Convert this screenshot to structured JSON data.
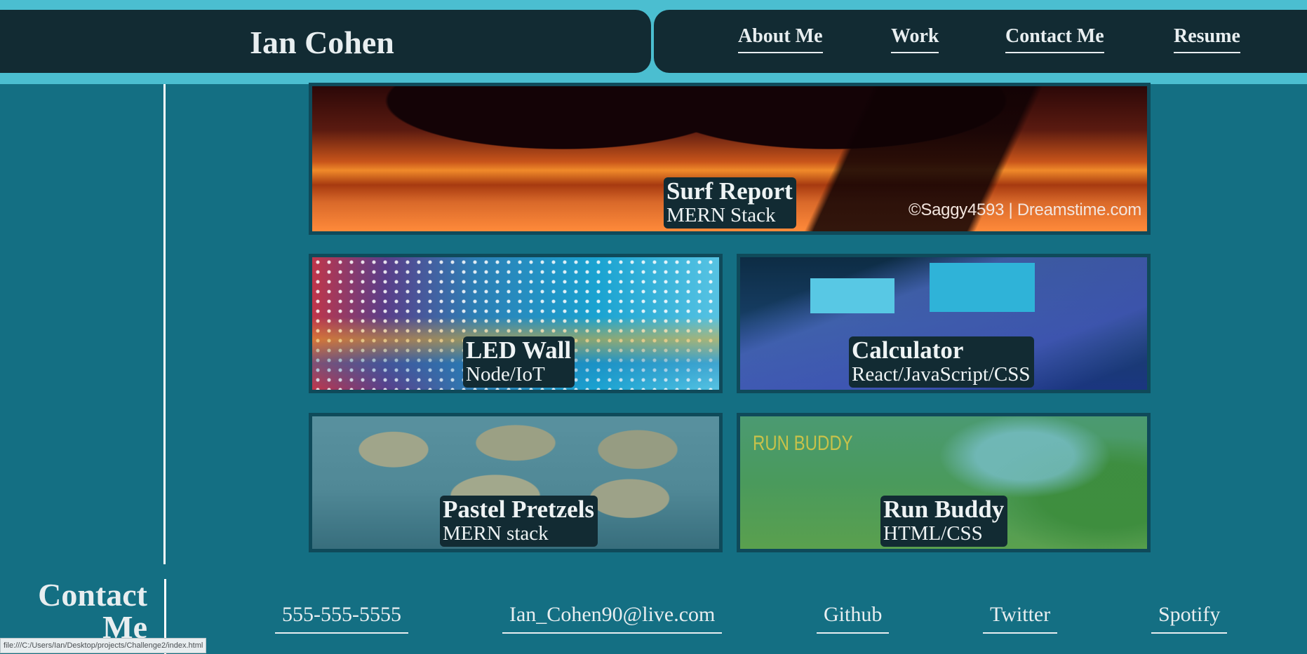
{
  "header": {
    "name": "Ian Cohen",
    "nav": [
      "About Me",
      "Work",
      "Contact Me",
      "Resume"
    ]
  },
  "work": {
    "featured": {
      "title": "Surf Report",
      "subtitle": "MERN Stack",
      "credit": "©Saggy4593 | Dreamstime.com"
    },
    "projects": [
      {
        "title": "LED Wall",
        "subtitle": "Node/IoT"
      },
      {
        "title": "Calculator",
        "subtitle": "React/JavaScript/CSS"
      },
      {
        "title": "Pastel Pretzels",
        "subtitle": "MERN stack"
      },
      {
        "title": "Run Buddy",
        "subtitle": "HTML/CSS",
        "image_text": "RUN BUDDY"
      }
    ]
  },
  "contact": {
    "heading": "Contact Me",
    "links": [
      "555-555-5555",
      "Ian_Cohen90@live.com",
      "Github",
      "Twitter",
      "Spotify"
    ]
  },
  "status_bar": {
    "url": "file:///C:/Users/Ian/Desktop/projects/Challenge2/index.html"
  },
  "colors": {
    "page_bg": "#146f83",
    "header_band": "#4bbed0",
    "header_bar": "#122b33",
    "caption_bg": "#122b33",
    "card_border": "#0f4a5a"
  }
}
